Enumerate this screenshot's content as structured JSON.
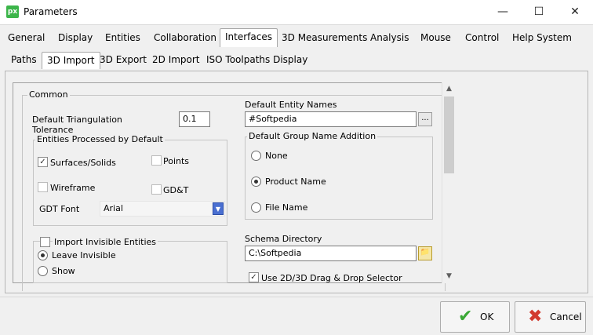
{
  "window": {
    "app_icon_text": "px",
    "title": "Parameters"
  },
  "main_tabs": [
    {
      "label": "General"
    },
    {
      "label": "Display"
    },
    {
      "label": "Entities"
    },
    {
      "label": "Collaboration"
    },
    {
      "label": "Interfaces"
    },
    {
      "label": "3D Measurements"
    },
    {
      "label": "Analysis"
    },
    {
      "label": "Mouse"
    },
    {
      "label": "Control"
    },
    {
      "label": "Help System"
    }
  ],
  "active_main_tab": "Interfaces",
  "sub_tabs": [
    {
      "label": "Paths"
    },
    {
      "label": "3D Import"
    },
    {
      "label": "3D Export"
    },
    {
      "label": "2D Import"
    },
    {
      "label": "ISO Toolpaths Display"
    }
  ],
  "active_sub_tab": "3D Import",
  "common": {
    "title": "Common",
    "triangulation_label": "Default Triangulation\nTolerance",
    "triangulation_value": "0.1",
    "entities_group": {
      "title": "Entities Processed by Default",
      "surfaces": "Surfaces/Solids",
      "points": "Points",
      "wireframe": "Wireframe",
      "gdt": "GD&T",
      "gdt_font_label": "GDT Font",
      "gdt_font_value": "Arial"
    },
    "invisible_group": {
      "title": "Import Invisible Entities",
      "leave_invisible": "Leave Invisible",
      "show": "Show"
    },
    "entity_names_label": "Default Entity Names",
    "entity_names_value": "#Softpedia",
    "browse_label": "...",
    "group_name_group": {
      "title": "Default Group Name Addition",
      "none": "None",
      "product_name": "Product Name",
      "file_name": "File Name"
    },
    "schema_label": "Schema Directory",
    "schema_value": "C:\\Softpedia",
    "drag_drop_label": "Use 2D/3D Drag & Drop Selector"
  },
  "buttons": {
    "ok": "OK",
    "cancel": "Cancel"
  },
  "icons": {
    "ok": "check-icon",
    "cancel": "x-icon"
  },
  "colors": {
    "app_icon": "#3cb54a",
    "ok_icon": "#3aa835",
    "cancel_icon": "#d23a2f",
    "combo_button": "#4a6fd1"
  }
}
